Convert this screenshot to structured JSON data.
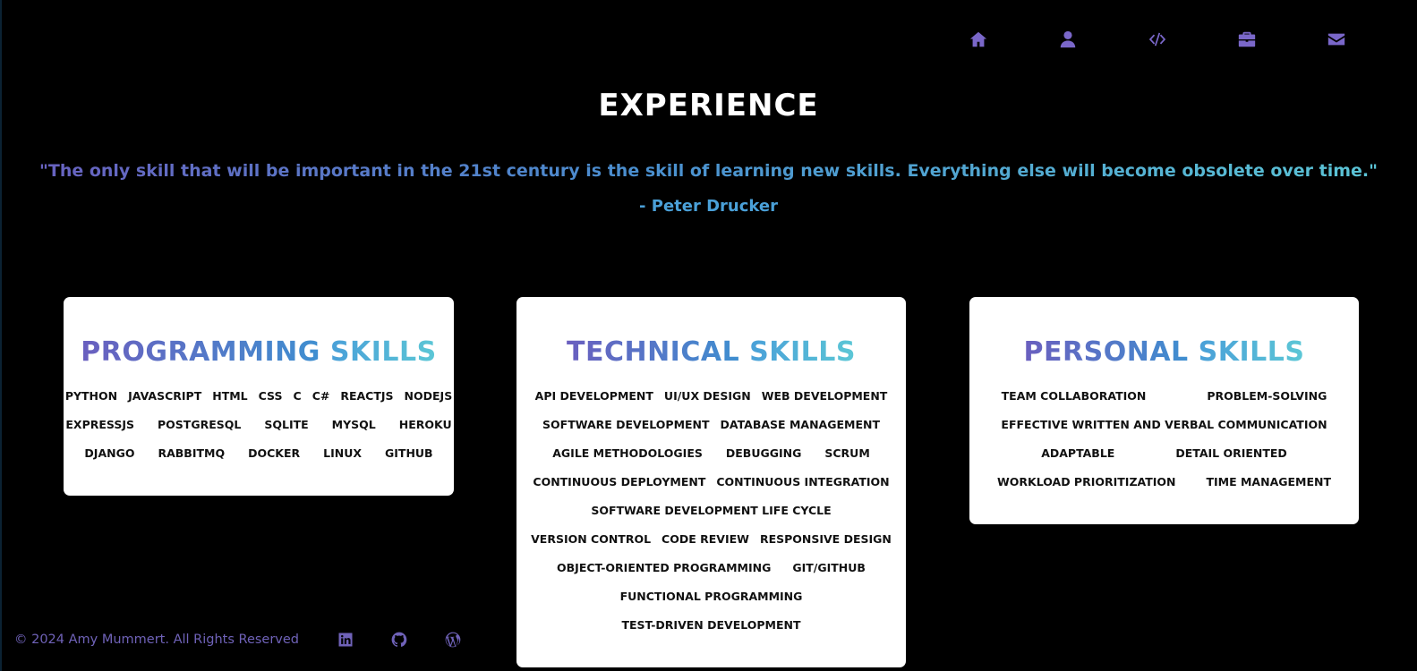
{
  "nav": {
    "items": [
      {
        "icon": "home-icon"
      },
      {
        "icon": "user-icon"
      },
      {
        "icon": "code-icon"
      },
      {
        "icon": "briefcase-icon"
      },
      {
        "icon": "envelope-icon"
      }
    ],
    "icon_color": "#7a67c9"
  },
  "header": {
    "title": "EXPERIENCE",
    "quote": "\"The only skill that will be important in the 21st century is the skill of learning new skills. Everything else will become obsolete over time.\"",
    "author": "- Peter Drucker"
  },
  "cards": {
    "programming": {
      "title_word1": "PROGRAMMING",
      "title_word2": "SKILLS",
      "rows": [
        [
          "PYTHON",
          "JAVASCRIPT",
          "HTML",
          "CSS",
          "C",
          "C#",
          "REACTJS",
          "NODEJS"
        ],
        [
          "EXPRESSJS",
          "POSTGRESQL",
          "SQLITE",
          "MYSQL",
          "HEROKU"
        ],
        [
          "DJANGO",
          "RABBITMQ",
          "DOCKER",
          "LINUX",
          "GITHUB"
        ]
      ]
    },
    "technical": {
      "title_word1": "TECHNICAL",
      "title_word2": "SKILLS",
      "rows": [
        [
          "API DEVELOPMENT",
          "UI/UX DESIGN",
          "WEB DEVELOPMENT"
        ],
        [
          "SOFTWARE DEVELOPMENT",
          "DATABASE MANAGEMENT"
        ],
        [
          "AGILE METHODOLOGIES",
          "DEBUGGING",
          "SCRUM"
        ],
        [
          "CONTINUOUS DEPLOYMENT",
          "CONTINUOUS INTEGRATION"
        ],
        [
          "SOFTWARE DEVELOPMENT LIFE CYCLE"
        ],
        [
          "VERSION CONTROL",
          "CODE REVIEW",
          "RESPONSIVE DESIGN"
        ],
        [
          "OBJECT-ORIENTED PROGRAMMING",
          "GIT/GITHUB"
        ],
        [
          "FUNCTIONAL PROGRAMMING"
        ],
        [
          "TEST-DRIVEN DEVELOPMENT"
        ]
      ]
    },
    "personal": {
      "title_word1": "PERSONAL",
      "title_word2": "SKILLS",
      "rows": [
        [
          "TEAM COLLABORATION",
          "PROBLEM-SOLVING"
        ],
        [
          "EFFECTIVE WRITTEN AND VERBAL COMMUNICATION"
        ],
        [
          "ADAPTABLE",
          "DETAIL ORIENTED"
        ],
        [
          "WORKLOAD PRIORITIZATION",
          "TIME MANAGEMENT"
        ]
      ]
    }
  },
  "footer": {
    "copyright": "© 2024 Amy Mummert. All Rights Reserved",
    "social": [
      {
        "icon": "linkedin-icon"
      },
      {
        "icon": "github-icon"
      },
      {
        "icon": "wordpress-icon"
      }
    ],
    "color": "#6f62b8"
  }
}
